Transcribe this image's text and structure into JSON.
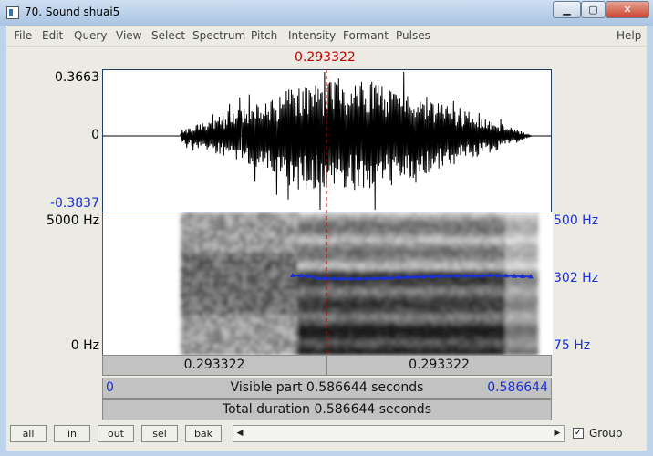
{
  "window": {
    "title": "70. Sound shuai5",
    "close_glyph": "✕",
    "min_glyph": "▁",
    "max_glyph": "▢"
  },
  "menu": [
    "File",
    "Edit",
    "Query",
    "View",
    "Select",
    "Spectrum",
    "Pitch",
    "Intensity",
    "Formant",
    "Pulses",
    "Help"
  ],
  "cursor_time": "0.293322",
  "waveform": {
    "max_label": "0.3663",
    "zero_label": "0",
    "min_label": "-0.3837"
  },
  "spectrogram": {
    "top_label": "5000 Hz",
    "bottom_label": "0 Hz"
  },
  "pitch": {
    "top_label": "500 Hz",
    "current_label": "302 Hz",
    "bottom_label": "75 Hz",
    "color": "#1a2fd6"
  },
  "bars": {
    "left_time": "0.293322",
    "right_time": "0.293322",
    "visible_start": "0",
    "visible_text": "Visible part 0.586644 seconds",
    "visible_end": "0.586644",
    "total_text": "Total duration 0.586644 seconds"
  },
  "toolbar": {
    "all": "all",
    "in": "in",
    "out": "out",
    "sel": "sel",
    "bak": "bak",
    "group_label": "Group",
    "group_checked": "✓",
    "left_arrow": "◀",
    "right_arrow": "▶"
  }
}
